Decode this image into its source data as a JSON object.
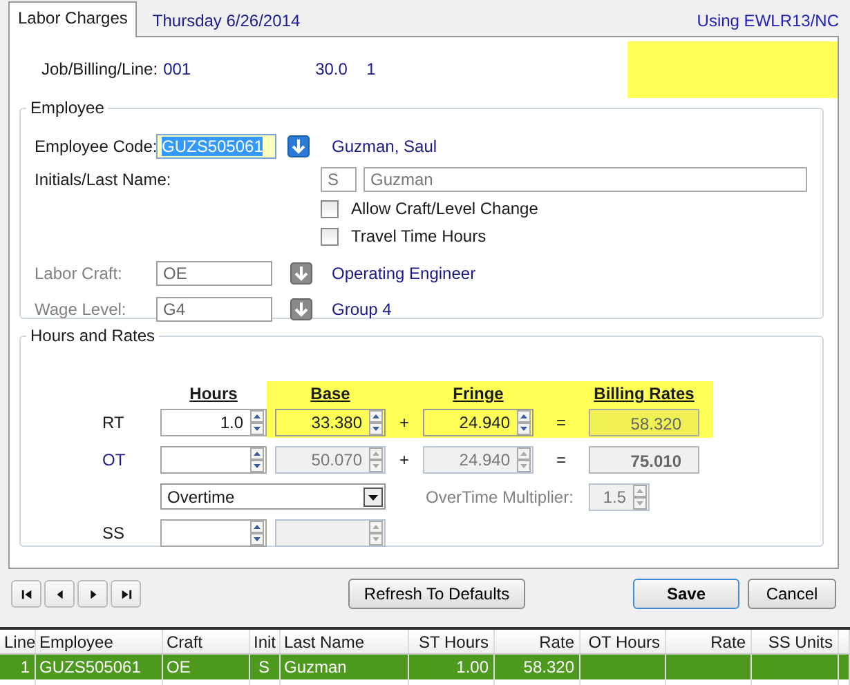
{
  "tabs": [
    {
      "label": "Labor Charges",
      "selected": true
    }
  ],
  "date": "Thursday  6/26/2014",
  "using": "Using EWLR13/NC",
  "job": {
    "label": "Job/Billing/Line:",
    "job": "001",
    "billing": "30.0",
    "line": "1",
    "flagged": true
  },
  "employee": {
    "title": "Employee",
    "code_label": "Employee Code:",
    "code": "GUZS505061",
    "name": "Guzman, Saul",
    "initials_label": "Initials/Last Name:",
    "initials": "S",
    "last_name": "Guzman",
    "checkboxes": [
      {
        "label": "Allow Craft/Level Change",
        "checked": false
      },
      {
        "label": "Travel Time Hours",
        "checked": false
      }
    ],
    "lookups": [
      {
        "label": "Labor Craft:",
        "value": "OE",
        "description": "Operating Engineer",
        "disabled": true
      },
      {
        "label": "Wage Level:",
        "value": "G4",
        "description": "Group 4",
        "disabled": true
      }
    ]
  },
  "rates": {
    "title": "Hours and Rates",
    "headers": [
      "Hours",
      "Base",
      "Fringe",
      "Billing Rates"
    ],
    "rows": [
      {
        "kind": "rate",
        "label": "RT",
        "link": false,
        "highlighted": true,
        "cells": [
          {
            "kind": "spinner",
            "value": "1.0",
            "disabled": false
          },
          {
            "kind": "spinner",
            "value": "33.380",
            "disabled": false
          },
          {
            "kind": "operator",
            "value": "+"
          },
          {
            "kind": "spinner",
            "value": "24.940",
            "disabled": false
          },
          {
            "kind": "operator",
            "value": "="
          },
          {
            "kind": "readonly",
            "value": "58.320"
          }
        ]
      },
      {
        "kind": "rate",
        "label": "OT",
        "link": true,
        "highlighted": false,
        "cells": [
          {
            "kind": "spinner",
            "disabled": false
          },
          {
            "kind": "spinner",
            "value": "50.070",
            "disabled": true
          },
          {
            "kind": "operator",
            "value": "+"
          },
          {
            "kind": "spinner",
            "value": "24.940",
            "disabled": true
          },
          {
            "kind": "operator",
            "value": "="
          },
          {
            "kind": "readonly",
            "value": "75.010"
          }
        ]
      },
      {
        "kind": "option",
        "dropdown": "Overtime",
        "multiplier_label": "OverTime Multiplier:",
        "multiplier": "1.5"
      },
      {
        "kind": "rate",
        "label": "SS",
        "link": false,
        "highlighted": false,
        "cells": [
          {
            "kind": "spinner",
            "disabled": false
          },
          {
            "kind": "spinner",
            "disabled": true
          }
        ]
      }
    ]
  },
  "nav_buttons": [
    {
      "kind": "first"
    },
    {
      "kind": "prev"
    },
    {
      "kind": "next"
    },
    {
      "kind": "last"
    }
  ],
  "refresh": "Refresh To Defaults",
  "buttons": [
    {
      "label": "Save",
      "default": true
    },
    {
      "label": "Cancel",
      "default": false
    }
  ],
  "grid": {
    "columns": [
      "Line",
      "Employee",
      "Craft",
      "Init",
      "Last Name",
      "ST Hours",
      "Rate",
      "OT Hours",
      "Rate",
      "SS Units"
    ],
    "rows": [
      {
        "selected": true,
        "cells": [
          "1",
          "GUZS505061",
          "OE",
          "S",
          "Guzman",
          "1.00",
          "58.320",
          "",
          "",
          ""
        ]
      }
    ]
  }
}
